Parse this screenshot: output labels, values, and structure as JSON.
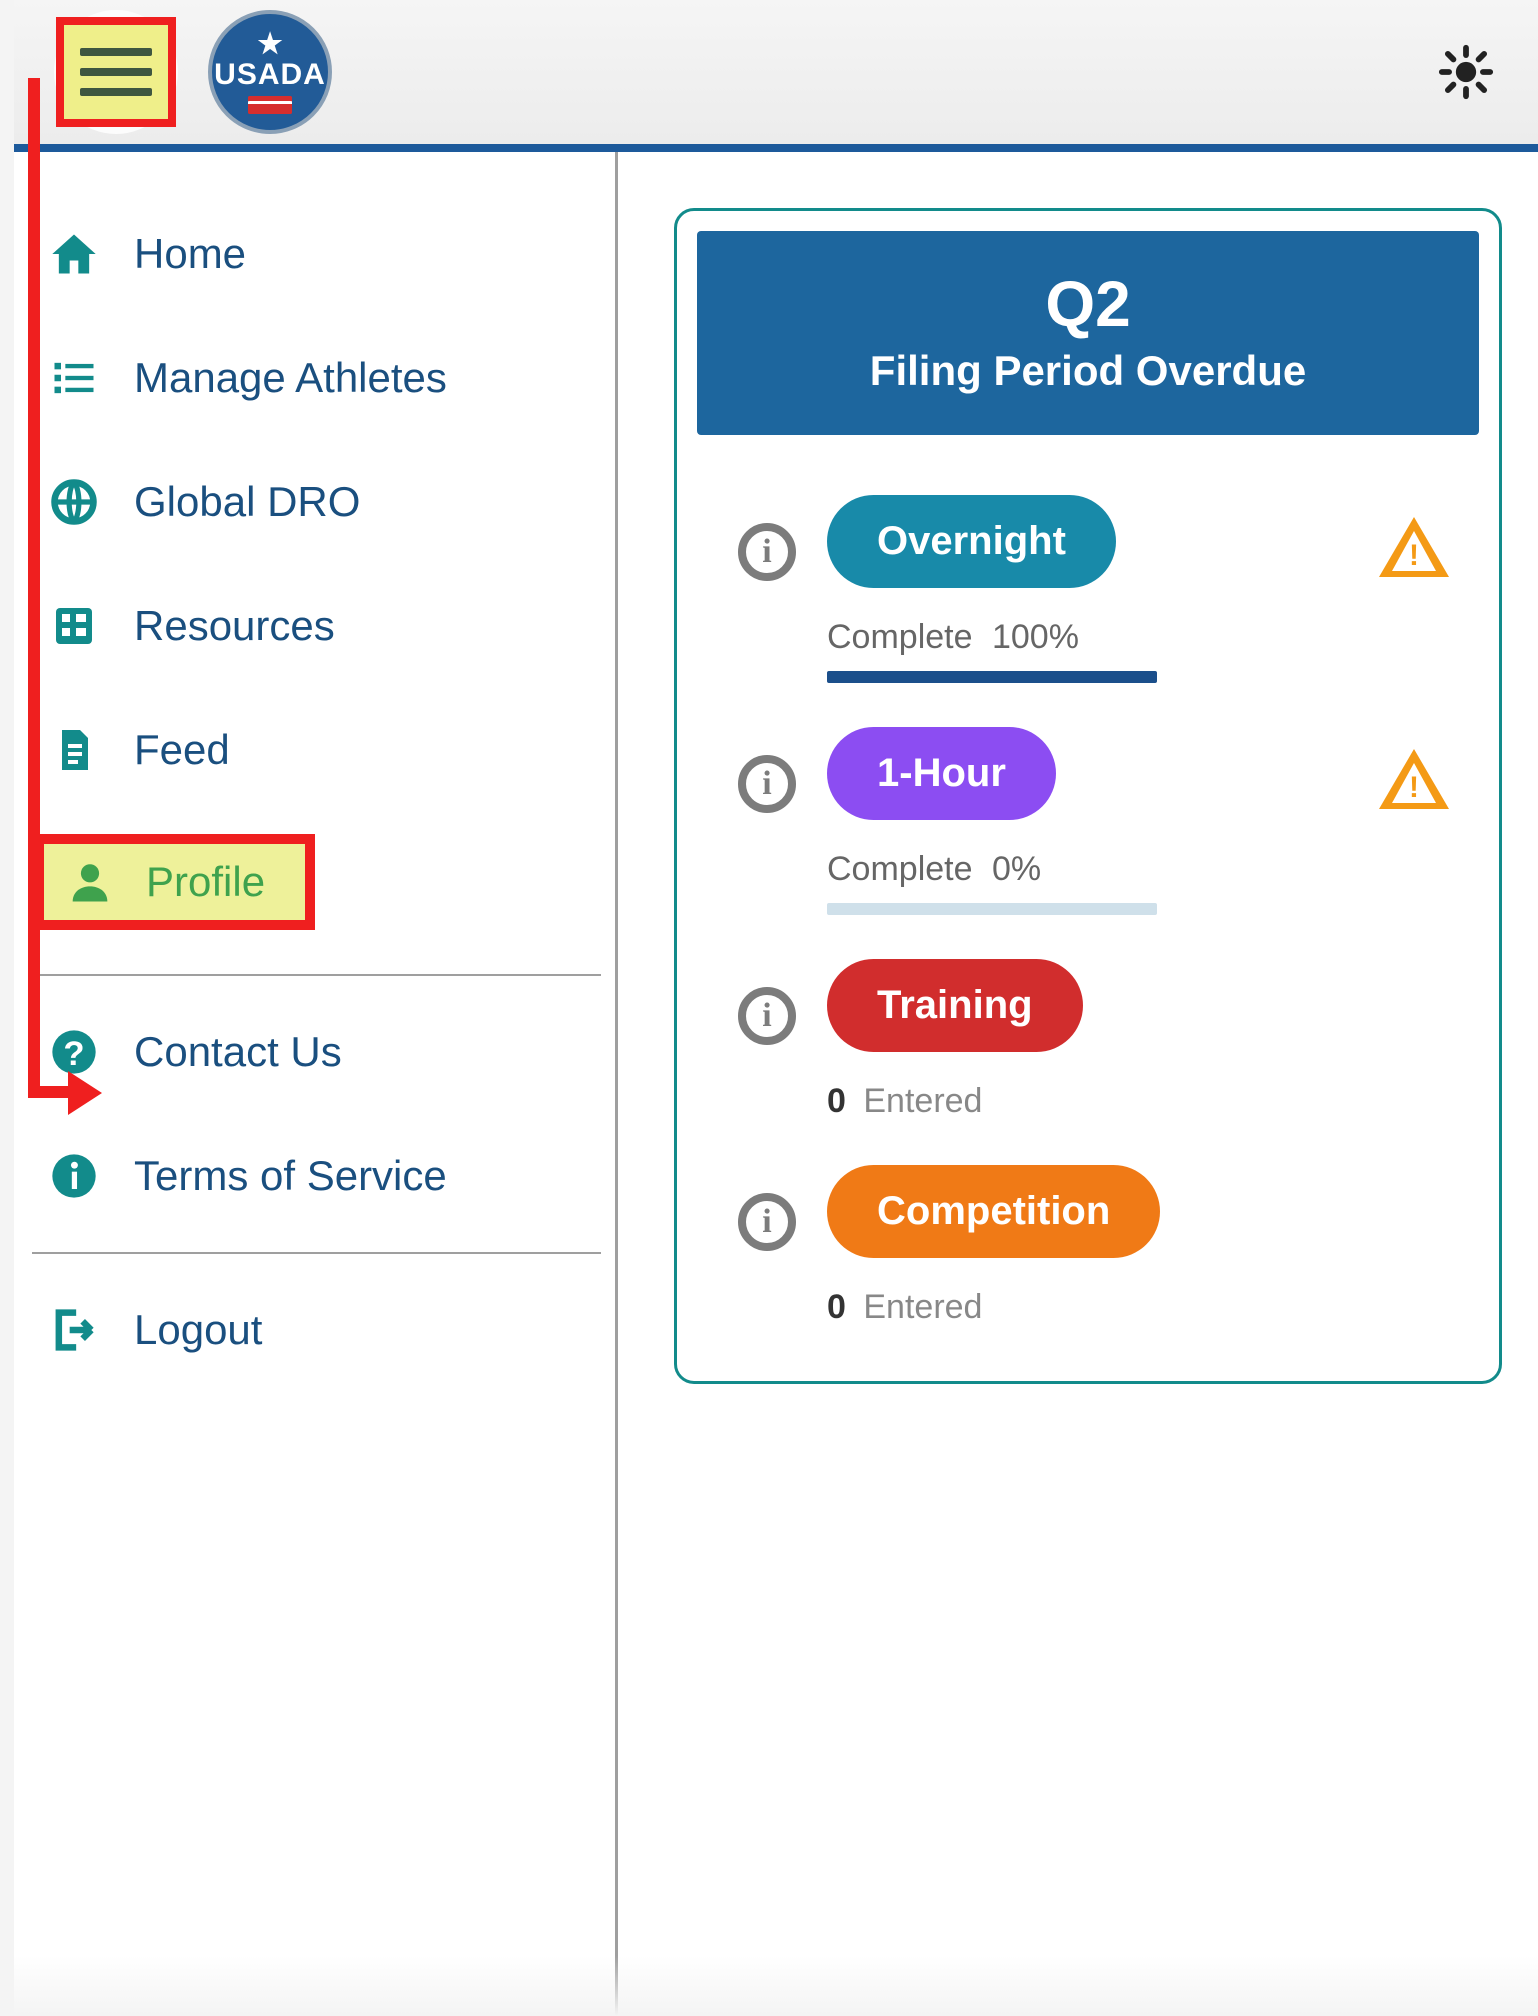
{
  "header": {
    "logo_text": "USADA"
  },
  "sidebar": {
    "items": [
      {
        "label": "Home"
      },
      {
        "label": "Manage Athletes"
      },
      {
        "label": "Global DRO"
      },
      {
        "label": "Resources"
      },
      {
        "label": "Feed"
      },
      {
        "label": "Profile"
      },
      {
        "label": "Contact Us"
      },
      {
        "label": "Terms of Service"
      },
      {
        "label": "Logout"
      }
    ]
  },
  "panel": {
    "quarter": "Q2",
    "subtitle": "Filing Period Overdue",
    "entries": [
      {
        "pill": "Overnight",
        "status_label": "Complete",
        "status_value": "100%",
        "warn": true
      },
      {
        "pill": "1-Hour",
        "status_label": "Complete",
        "status_value": "0%",
        "warn": true
      },
      {
        "pill": "Training",
        "count": "0",
        "count_label": "Entered"
      },
      {
        "pill": "Competition",
        "count": "0",
        "count_label": "Entered"
      }
    ]
  }
}
